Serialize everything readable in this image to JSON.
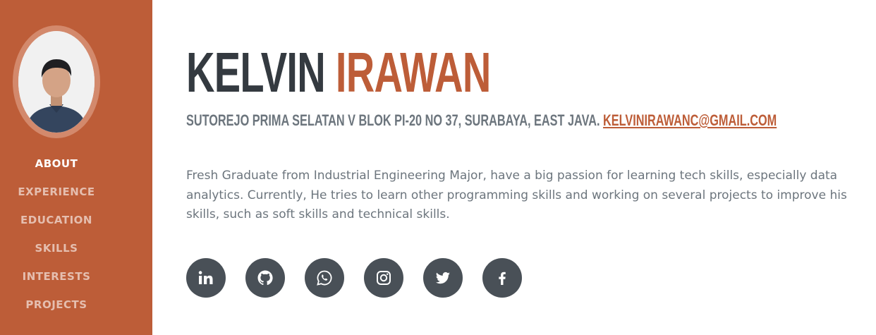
{
  "sidebar": {
    "avatar_icon": "profile-photo",
    "nav": [
      {
        "label": "ABOUT",
        "active": true
      },
      {
        "label": "EXPERIENCE",
        "active": false
      },
      {
        "label": "EDUCATION",
        "active": false
      },
      {
        "label": "SKILLS",
        "active": false
      },
      {
        "label": "INTERESTS",
        "active": false
      },
      {
        "label": "PROJECTS",
        "active": false
      }
    ]
  },
  "about": {
    "first_name": "KELVIN",
    "last_name": "IRAWAN",
    "address": "SUTOREJO PRIMA SELATAN V BLOK PI-20 NO 37, SURABAYA, EAST JAVA.",
    "email": "KELVINIRAWANC@GMAIL.COM",
    "lead": "Fresh Graduate from Industrial Engineering Major, have a big passion for learning tech skills, especially data analytics. Currently, He tries to learn other programming skills and working on several projects to improve his skills, such as soft skills and technical skills."
  },
  "social": [
    {
      "icon": "linkedin-icon"
    },
    {
      "icon": "github-icon"
    },
    {
      "icon": "whatsapp-icon"
    },
    {
      "icon": "instagram-icon"
    },
    {
      "icon": "twitter-icon"
    },
    {
      "icon": "facebook-icon"
    }
  ],
  "colors": {
    "primary": "#bd5d38",
    "heading": "#343a40",
    "muted": "#6c757d",
    "social_bg": "#495057"
  }
}
